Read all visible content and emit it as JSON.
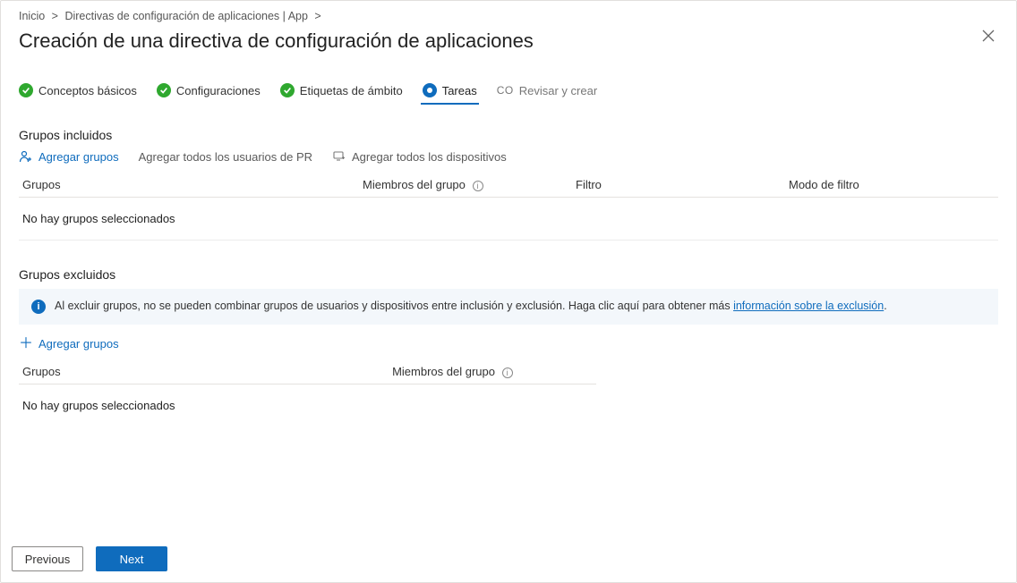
{
  "breadcrumb": {
    "items": [
      "Inicio",
      "Directivas de configuración de aplicaciones | App"
    ],
    "separator": ">"
  },
  "page": {
    "title": "Creación de una directiva de configuración de aplicaciones"
  },
  "stepper": {
    "steps": [
      {
        "label": "Conceptos básicos",
        "state": "done"
      },
      {
        "label": "Configuraciones",
        "state": "done"
      },
      {
        "label": "Etiquetas de ámbito",
        "state": "done"
      },
      {
        "label": "Tareas",
        "state": "current"
      },
      {
        "label": "Revisar y crear",
        "state": "pending",
        "prefix": "CO"
      }
    ]
  },
  "included": {
    "title": "Grupos incluidos",
    "actions": {
      "add_groups": "Agregar grupos",
      "add_all_users": "Agregar todos los usuarios de PR",
      "add_all_devices": "Agregar todos los dispositivos"
    },
    "columns": {
      "groups": "Grupos",
      "members": "Miembros del grupo",
      "filter": "Filtro",
      "filter_mode": "Modo de filtro"
    },
    "empty": "No hay grupos seleccionados"
  },
  "excluded": {
    "title": "Grupos excluidos",
    "banner": {
      "text": "Al excluir grupos, no se pueden combinar grupos de usuarios y dispositivos entre inclusión y exclusión. Haga clic aquí para obtener más ",
      "link_text": "información sobre la exclusión",
      "suffix": "."
    },
    "actions": {
      "add_groups": "Agregar grupos"
    },
    "columns": {
      "groups": "Grupos",
      "members": "Miembros del grupo"
    },
    "empty": "No hay grupos seleccionados"
  },
  "footer": {
    "previous": "Previous",
    "next": "Next"
  }
}
